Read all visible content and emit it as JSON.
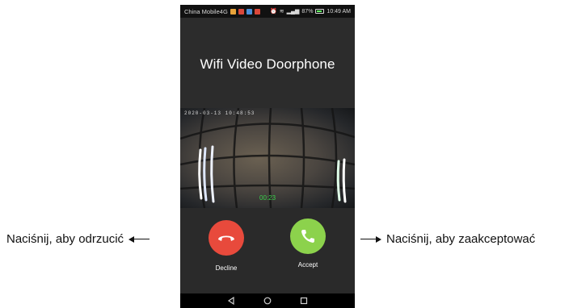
{
  "status_bar": {
    "carrier": "China Mobile4G",
    "battery": "87%",
    "time": "10:49 AM"
  },
  "app": {
    "title": "Wifi Video Doorphone"
  },
  "video": {
    "timestamp": "2020-03-13 10:48:53",
    "call_timer": "00:23"
  },
  "call": {
    "decline_label": "Decline",
    "accept_label": "Accept",
    "decline_icon": "phone-hangup-icon",
    "accept_icon": "phone-icon"
  },
  "nav_bar": {
    "icons": [
      "back-icon",
      "home-icon",
      "recents-icon"
    ]
  },
  "annotations": {
    "left": "Naciśnij, aby odrzucić",
    "right": "Naciśnij, aby zaakceptować"
  },
  "colors": {
    "decline": "#e84a3c",
    "accept": "#8cd24c",
    "timer": "#3ad14a"
  }
}
